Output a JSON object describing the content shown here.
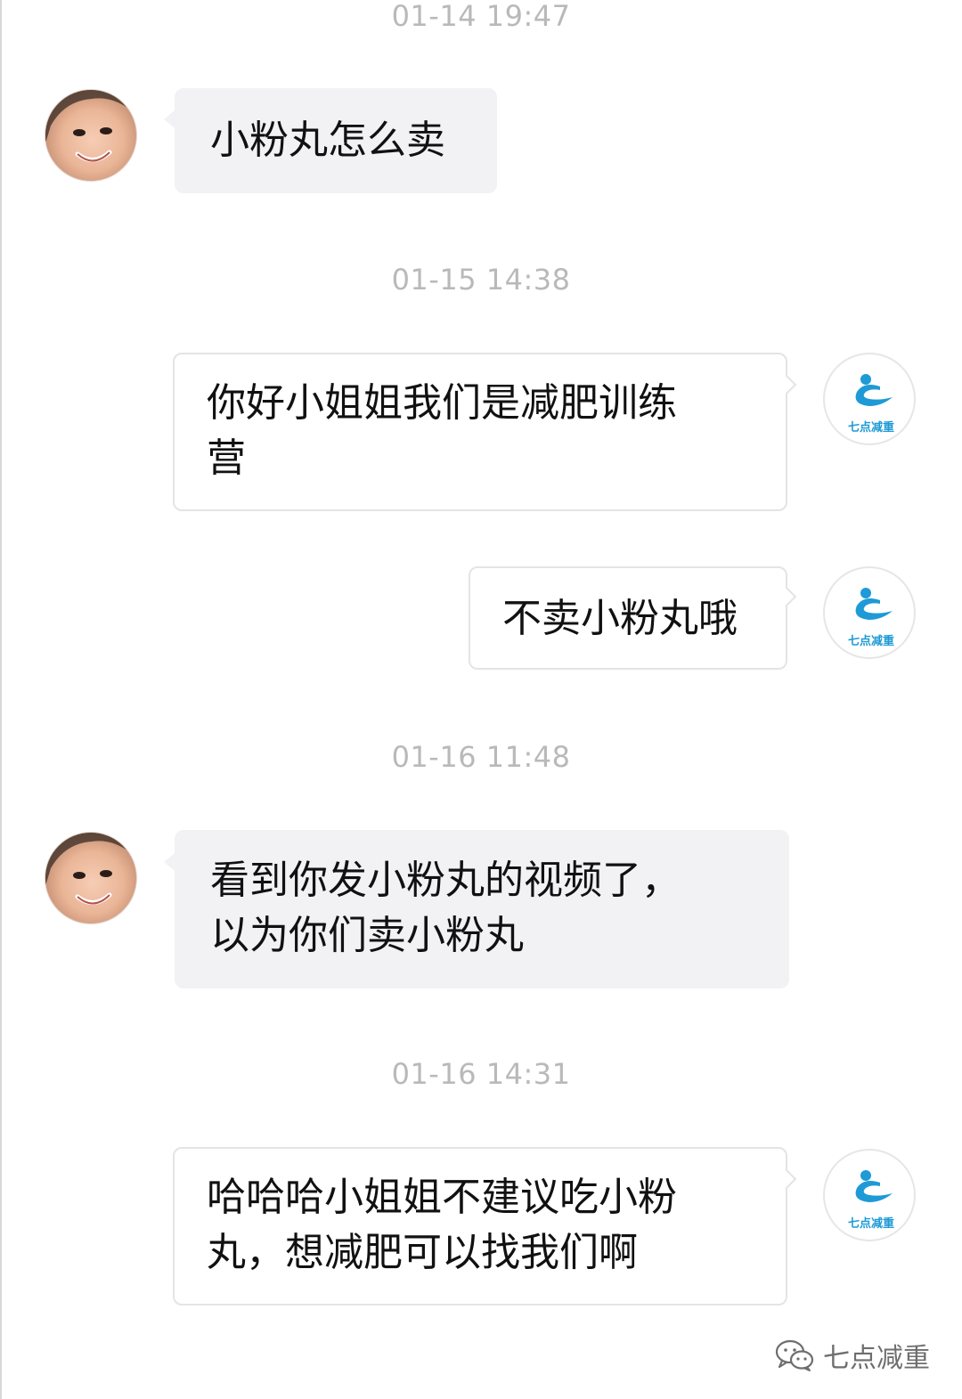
{
  "chat": {
    "messages": [
      {
        "timestamp": "01-14 19:47",
        "sender": "user",
        "text": "小粉丸怎么卖"
      },
      {
        "timestamp": "01-15 14:38",
        "sender": "brand",
        "text": "你好小姐姐我们是减肥训练营"
      },
      {
        "timestamp": "",
        "sender": "brand",
        "text": "不卖小粉丸哦"
      },
      {
        "timestamp": "01-16 11:48",
        "sender": "user",
        "text": "看到你发小粉丸的视频了，以为你们卖小粉丸"
      },
      {
        "timestamp": "01-16 14:31",
        "sender": "brand",
        "text": "哈哈哈小姐姐不建议吃小粉丸，想减肥可以找我们啊"
      }
    ],
    "lines": {
      "m2": [
        "你好小姐姐我们是减肥训练",
        "营"
      ],
      "m4": [
        "看到你发小粉丸的视频了，",
        "以为你们卖小粉丸"
      ],
      "m5": [
        "哈哈哈小姐姐不建议吃小粉",
        "丸，想减肥可以找我们啊"
      ]
    }
  },
  "brand": {
    "avatar_text": "七点减重",
    "color": "#1e9ad6"
  },
  "watermark": {
    "icon": "wechat-icon",
    "text": "七点减重"
  }
}
